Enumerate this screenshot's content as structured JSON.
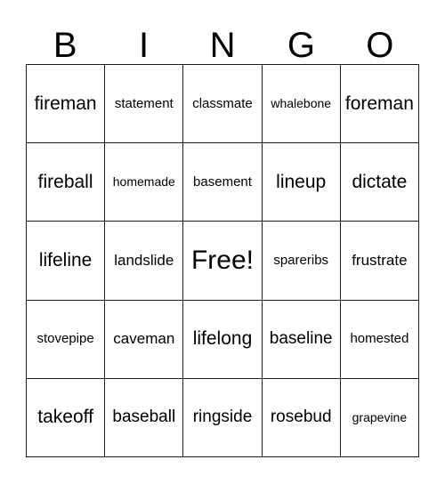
{
  "header": {
    "letters": [
      "B",
      "I",
      "N",
      "G",
      "O"
    ]
  },
  "grid": {
    "rows": [
      [
        {
          "label": "fireman",
          "size": "fs-xl"
        },
        {
          "label": "statement",
          "size": "fs-sm"
        },
        {
          "label": "classmate",
          "size": "fs-sm"
        },
        {
          "label": "whalebone",
          "size": "fs-xs"
        },
        {
          "label": "foreman",
          "size": "fs-xl"
        }
      ],
      [
        {
          "label": "fireball",
          "size": "fs-xl"
        },
        {
          "label": "homemade",
          "size": "fs-xs"
        },
        {
          "label": "basement",
          "size": "fs-sm"
        },
        {
          "label": "lineup",
          "size": "fs-xl"
        },
        {
          "label": "dictate",
          "size": "fs-xl"
        }
      ],
      [
        {
          "label": "lifeline",
          "size": "fs-xl"
        },
        {
          "label": "landslide",
          "size": "fs-md"
        },
        {
          "label": "Free!",
          "size": "fs-free"
        },
        {
          "label": "spareribs",
          "size": "fs-sm"
        },
        {
          "label": "frustrate",
          "size": "fs-md"
        }
      ],
      [
        {
          "label": "stovepipe",
          "size": "fs-sm"
        },
        {
          "label": "caveman",
          "size": "fs-md"
        },
        {
          "label": "lifelong",
          "size": "fs-xl"
        },
        {
          "label": "baseline",
          "size": "fs-lg"
        },
        {
          "label": "homested",
          "size": "fs-sm"
        }
      ],
      [
        {
          "label": "takeoff",
          "size": "fs-xl"
        },
        {
          "label": "baseball",
          "size": "fs-lg"
        },
        {
          "label": "ringside",
          "size": "fs-lg"
        },
        {
          "label": "rosebud",
          "size": "fs-lg"
        },
        {
          "label": "grapevine",
          "size": "fs-xs"
        }
      ]
    ]
  },
  "colors": {
    "background": "#ffffff",
    "text": "#000000",
    "border": "#1a1a1a"
  }
}
